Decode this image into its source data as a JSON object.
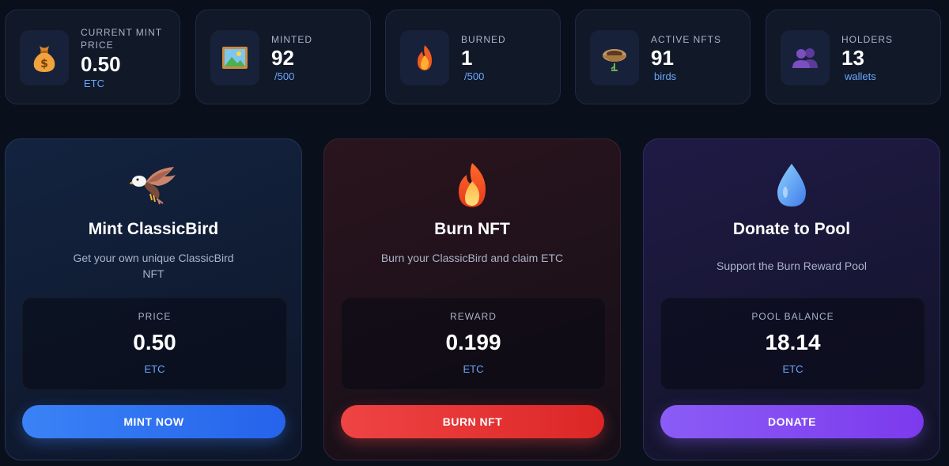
{
  "stats": [
    {
      "label": "CURRENT MINT PRICE",
      "value": "0.50",
      "unit": "ETC",
      "icon": "money-bag-icon"
    },
    {
      "label": "MINTED",
      "value": "92",
      "unit": "/500",
      "icon": "framed-picture-icon"
    },
    {
      "label": "BURNED",
      "value": "1",
      "unit": "/500",
      "icon": "fire-icon"
    },
    {
      "label": "ACTIVE NFTS",
      "value": "91",
      "unit": "birds",
      "icon": "nest-icon"
    },
    {
      "label": "HOLDERS",
      "value": "13",
      "unit": "wallets",
      "icon": "users-icon"
    }
  ],
  "cards": {
    "mint": {
      "icon": "eagle-icon",
      "title": "Mint ClassicBird",
      "description": "Get your own unique ClassicBird NFT",
      "box_label": "PRICE",
      "box_value": "0.50",
      "box_unit": "ETC",
      "button": "MINT NOW"
    },
    "burn": {
      "icon": "fire-icon",
      "title": "Burn NFT",
      "description": "Burn your ClassicBird and claim ETC",
      "box_label": "REWARD",
      "box_value": "0.199",
      "box_unit": "ETC",
      "button": "BURN NFT"
    },
    "donate": {
      "icon": "droplet-icon",
      "title": "Donate to Pool",
      "description": "Support the Burn Reward Pool",
      "box_label": "POOL BALANCE",
      "box_value": "18.14",
      "box_unit": "ETC",
      "button": "DONATE"
    }
  },
  "colors": {
    "background": "#0a0f1c",
    "accent_blue": "#3b82f6",
    "accent_red": "#ef4444",
    "accent_purple": "#8b5cf6",
    "unit_text": "#6aa8ff"
  }
}
